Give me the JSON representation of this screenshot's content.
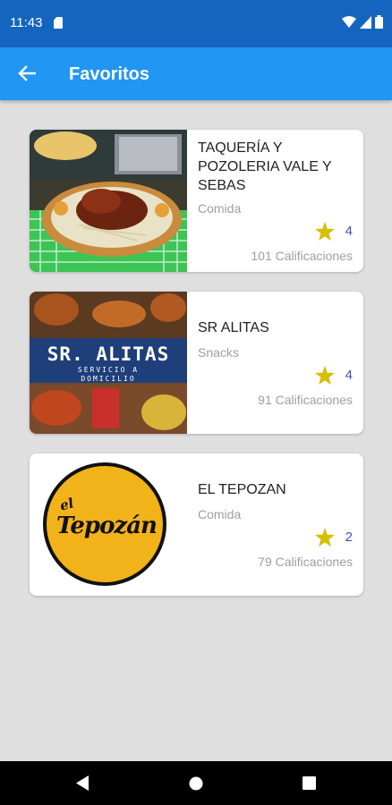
{
  "status_bar": {
    "time": "11:43"
  },
  "app_bar": {
    "title": "Favoritos"
  },
  "favorites": [
    {
      "name": "TAQUERÍA Y POZOLERIA VALE Y SEBAS",
      "category": "Comida",
      "rating": "4",
      "reviews": "101 Calificaciones"
    },
    {
      "name": "SR ALITAS",
      "category": "Snacks",
      "rating": "4",
      "reviews": "91 Calificaciones"
    },
    {
      "name": "EL TEPOZAN",
      "category": "Comida",
      "rating": "2",
      "reviews": "79 Calificaciones"
    }
  ],
  "images": {
    "sr_alitas_banner": "SR. ALITAS",
    "sr_alitas_sub1": "SERVICIO A",
    "sr_alitas_sub2": "DOMICILIO",
    "tepozan_logo_small": "el",
    "tepozan_logo_big": "Tepozán"
  },
  "colors": {
    "status_bar": "#1565c0",
    "app_bar": "#2196f3",
    "star": "#d4c000",
    "rating_text": "#3f51b5"
  },
  "icons": {
    "back": "arrow-back-icon",
    "star": "star-icon",
    "nav_back": "triangle-back-icon",
    "nav_home": "circle-home-icon",
    "nav_recents": "square-recents-icon"
  }
}
